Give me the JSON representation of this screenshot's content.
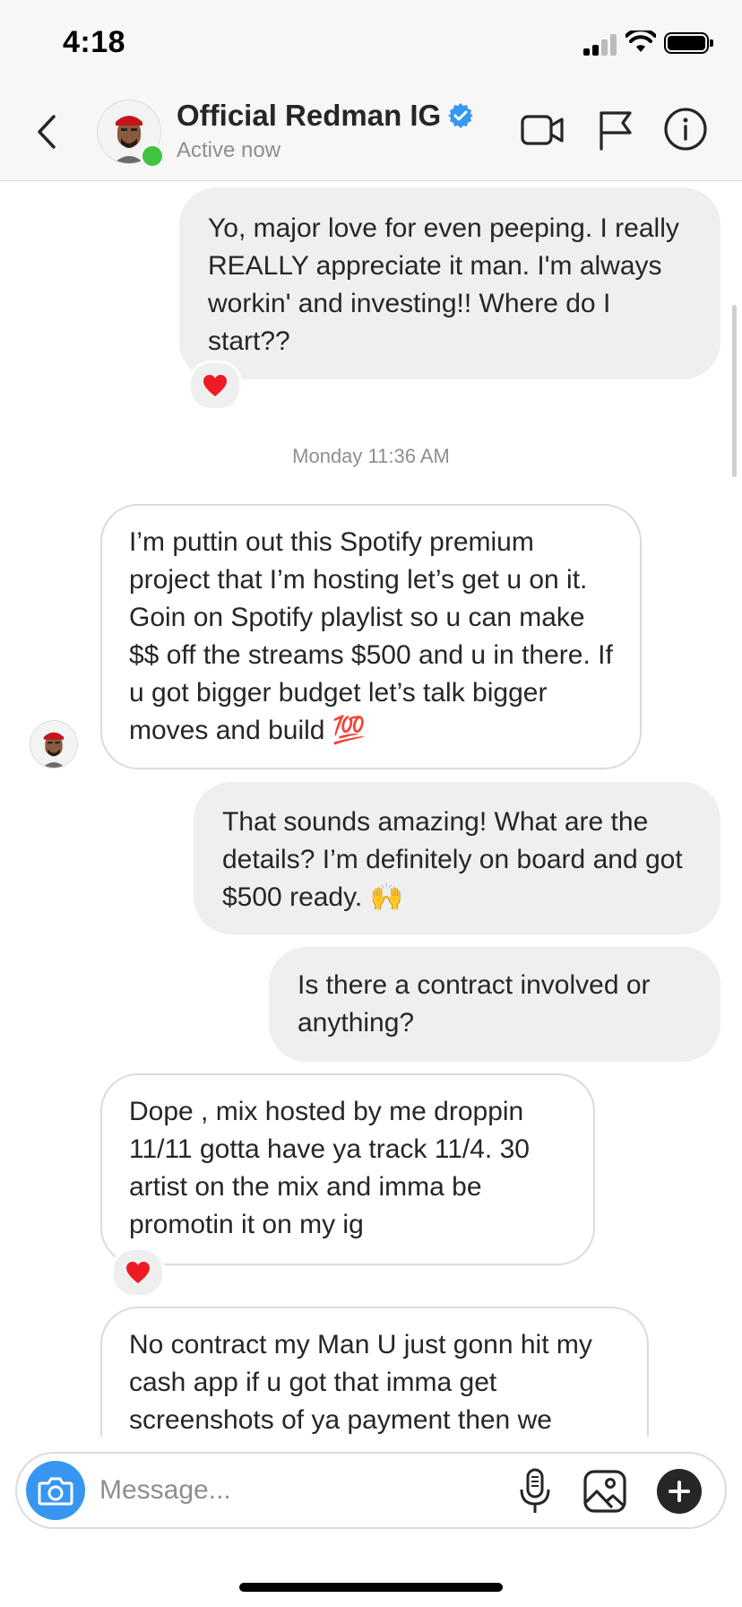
{
  "status_bar": {
    "time": "4:18"
  },
  "header": {
    "name": "Official Redman IG",
    "status": "Active now",
    "icons": [
      "back-icon",
      "video-call-icon",
      "flag-icon",
      "info-icon",
      "verified-badge-icon"
    ]
  },
  "messages": [
    {
      "from": "me",
      "text": "Yo, major love for even peeping. I really REALLY appreciate it man. I'm always workin' and investing!! Where do I start??",
      "reaction": "❤️"
    },
    {
      "from": "them",
      "text": "I’m puttin out this Spotify premium project that I’m hosting let’s get u on it. Goin on Spotify playlist so u can make $$ off the streams $500 and u in there. If u got bigger budget let’s talk bigger moves and build 💯"
    },
    {
      "from": "me",
      "text": "That sounds amazing! What are the details? I’m definitely on board and got $500 ready. 🙌"
    },
    {
      "from": "me",
      "text": "Is there a contract involved or anything?"
    },
    {
      "from": "them",
      "text": "Dope , mix hosted by me droppin 11/11 gotta have ya track 11/4. 30 artist on the mix and imma be promotin it on my ig",
      "reaction": "❤️"
    },
    {
      "from": "them",
      "text": "No contract my Man U just gonn hit my cash app if u got that imma get screenshots of ya payment then we"
    }
  ],
  "timestamp": "Monday 11:36 AM",
  "composer": {
    "placeholder": "Message...",
    "icons": [
      "camera-icon",
      "microphone-icon",
      "gallery-icon",
      "plus-icon"
    ],
    "accent": "#3797f0"
  },
  "colors": {
    "outgoing_bubble": "#efefef",
    "incoming_border": "#dbdbdb",
    "verified": "#3897f0",
    "active": "#3ec43e",
    "heart": "#ed1c24"
  }
}
